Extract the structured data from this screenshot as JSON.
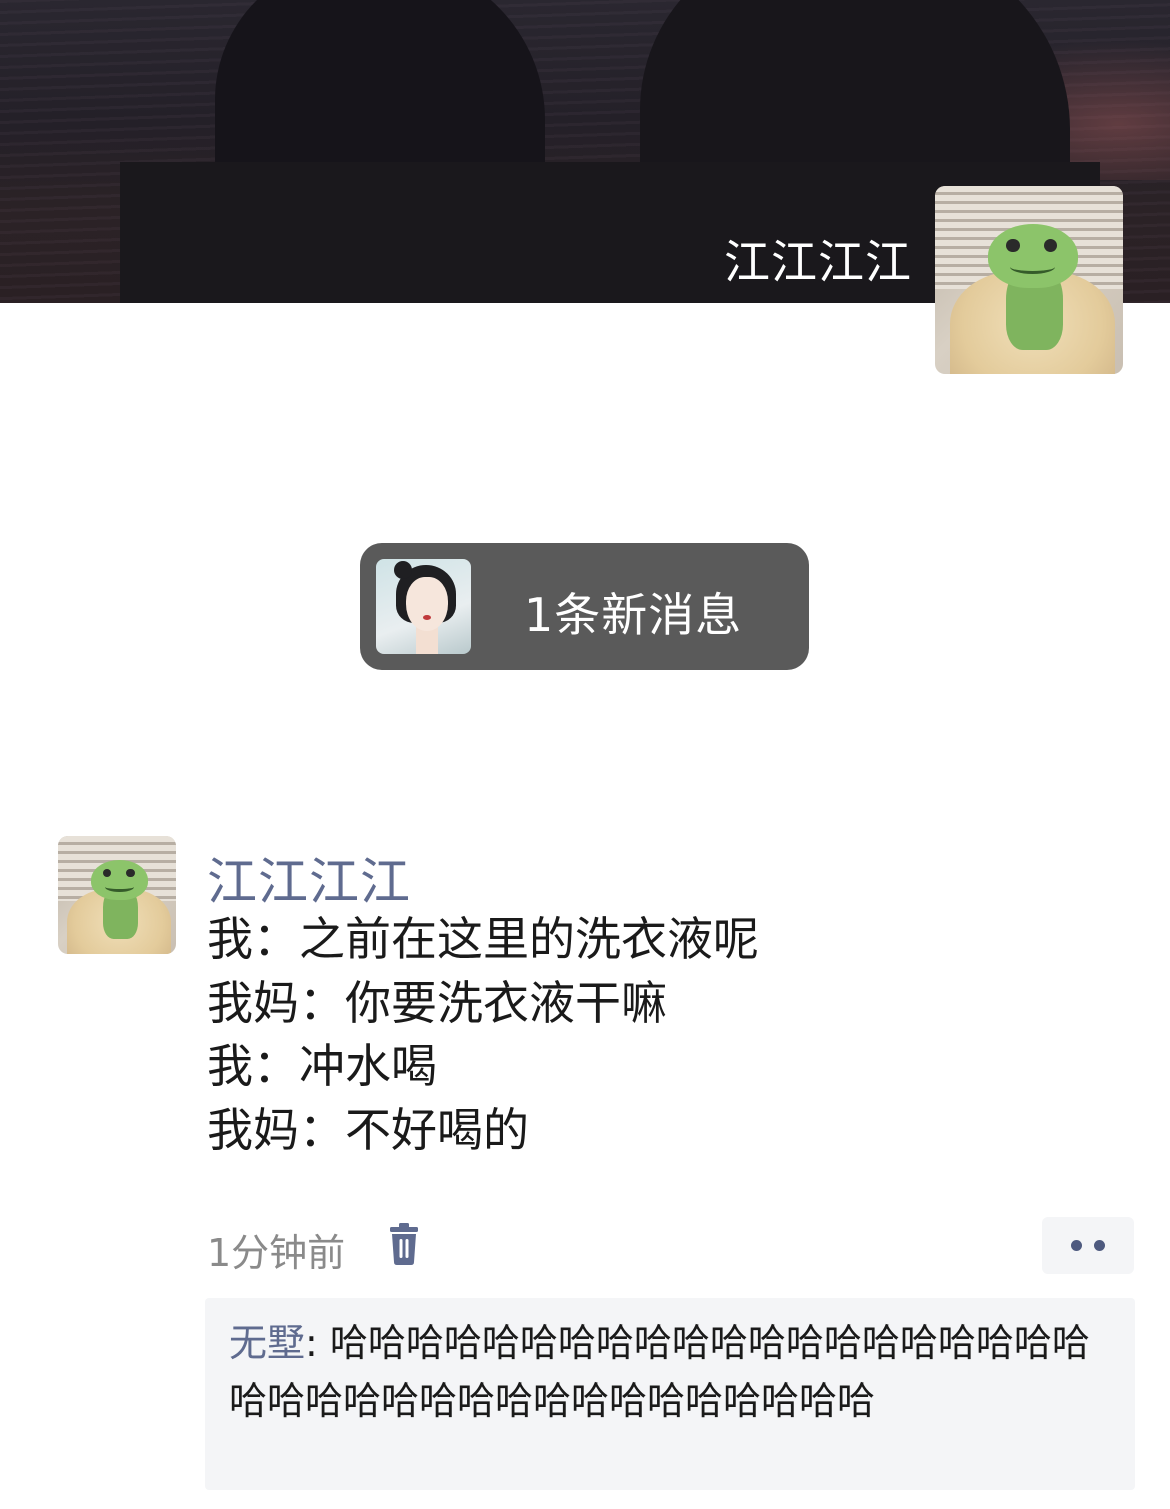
{
  "cover": {
    "profile_name": "江江江江"
  },
  "notification": {
    "label": "1条新消息"
  },
  "post": {
    "author": "江江江江",
    "lines": [
      "我：之前在这里的洗衣液呢",
      "我妈：你要洗衣液干嘛",
      "我：冲水喝",
      "我妈：不好喝的"
    ],
    "time": "1分钟前"
  },
  "comment": {
    "author": "无墅",
    "separator": ": ",
    "text": "哈哈哈哈哈哈哈哈哈哈哈哈哈哈哈哈哈哈哈哈哈哈哈哈哈哈哈哈哈哈哈哈哈哈哈哈哈"
  },
  "icons": {
    "delete": "trash-icon",
    "more": "more-dots-icon"
  },
  "colors": {
    "link_blue": "#5f6b8f",
    "pill_bg": "#5a5a5a",
    "comment_bg": "#f4f5f7",
    "time_gray": "#8a8a8a"
  }
}
